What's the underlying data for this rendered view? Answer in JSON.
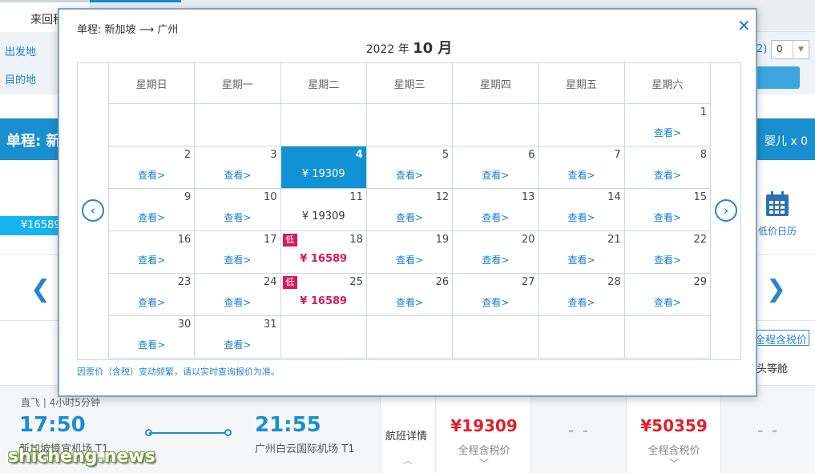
{
  "background": {
    "tabs": {
      "round_trip": "来回程"
    },
    "form": {
      "departure_label": "出发地",
      "arrival_label": "目的地",
      "infant_paren": "2)",
      "infant_select_value": "0"
    },
    "banner": {
      "title": "单程: 新",
      "infant_count": "婴儿 x 0"
    },
    "price_strip": "¥16589",
    "low_price_calendar_label": "低价日历",
    "tax_link": "全程含税价",
    "cabin_head": "头等舱",
    "flight": {
      "duration": "直飞 | 4小时5分钟",
      "dep_time": "17:50",
      "arr_time": "21:55",
      "dep_airport": "新加坡樟宜机场 T1",
      "arr_airport": "广州白云国际机场 T1",
      "detail_label": "航班详情",
      "fares": [
        {
          "price": "¥19309",
          "sub": "全程含税价"
        },
        {
          "price": "- -"
        },
        {
          "price": "¥50359",
          "sub": "全程含税价"
        },
        {
          "price": "- -"
        }
      ]
    }
  },
  "modal": {
    "route": "单程:  新加坡  ⟶  广州",
    "year_label": "2022 年",
    "month_label": "10 月",
    "weekdays": [
      "星期日",
      "星期一",
      "星期二",
      "星期三",
      "星期四",
      "星期五",
      "星期六"
    ],
    "view_label": "查看>",
    "low_badge": "低",
    "note": "因票价（含税）变动频繁，请以实时查询报价为准。",
    "days": {
      "1": "查看>",
      "2": "查看>",
      "3": "查看>",
      "4": "¥ 19309",
      "5": "查看>",
      "6": "查看>",
      "7": "查看>",
      "8": "查看>",
      "9": "查看>",
      "10": "查看>",
      "11": "¥ 19309",
      "12": "查看>",
      "13": "查看>",
      "14": "查看>",
      "15": "查看>",
      "16": "查看>",
      "17": "查看>",
      "18": "¥ 16589",
      "19": "查看>",
      "20": "查看>",
      "21": "查看>",
      "22": "查看>",
      "23": "查看>",
      "24": "查看>",
      "25": "¥ 16589",
      "26": "查看>",
      "27": "查看>",
      "28": "查看>",
      "29": "查看>",
      "30": "查看>",
      "31": "查看>"
    },
    "selected_day": "4"
  },
  "watermark": "shicheng.news"
}
